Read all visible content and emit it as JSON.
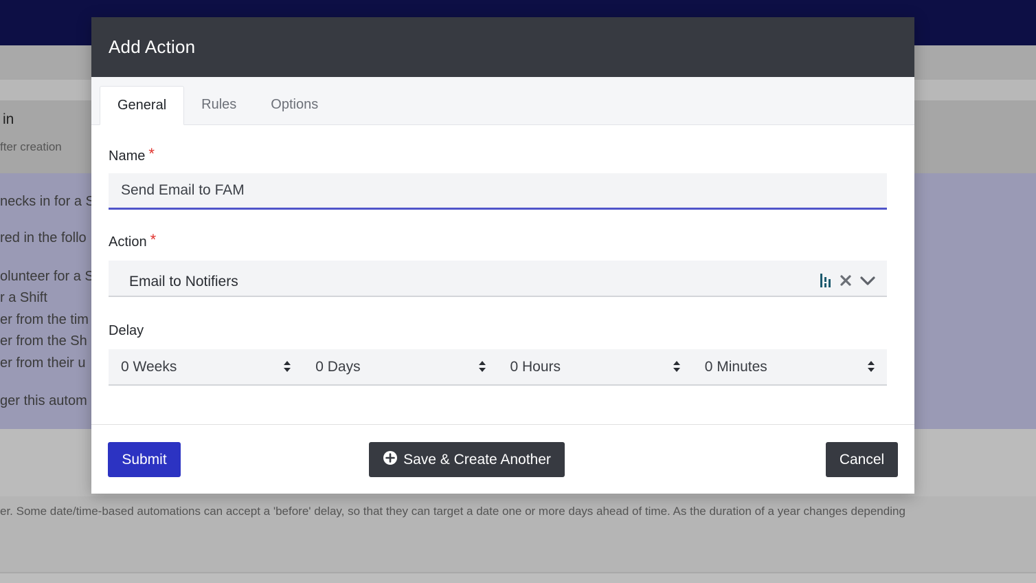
{
  "background": {
    "header_line1": "in",
    "header_line2": "fter creation",
    "rows": [
      "necks in for a S",
      "red in the follo",
      "olunteer for a S",
      "r a Shift",
      "er from the tim",
      "er from the Sh",
      "er from their u",
      "ger this autom"
    ],
    "footer_text": "er. Some date/time-based automations can accept a 'before' delay, so that they can target a date one or more days ahead of time. As the duration of a year changes depending"
  },
  "modal": {
    "title": "Add Action",
    "tabs": [
      {
        "label": "General"
      },
      {
        "label": "Rules"
      },
      {
        "label": "Options"
      }
    ],
    "name_label": "Name",
    "required_mark": "*",
    "name_value": "Send Email to FAM",
    "action_label": "Action",
    "action_value": "Email to Notifiers",
    "delay_label": "Delay",
    "delay": {
      "weeks": "0 Weeks",
      "days": "0 Days",
      "hours": "0 Hours",
      "minutes": "0 Minutes"
    },
    "buttons": {
      "submit": "Submit",
      "save_another": "Save & Create Another",
      "cancel": "Cancel"
    }
  },
  "icons": {
    "action_icon": "bars-icon",
    "clear": "close-icon",
    "dropdown": "chevron-down-icon",
    "plus": "plus-circle-icon",
    "spinner": "sort-updown-icon"
  },
  "colors": {
    "topbar": "#0d0f45",
    "modal_header": "#373a41",
    "primary": "#2c33c2",
    "required": "#e0322d",
    "input_focus": "#4f54c9",
    "icon_teal": "#1d5a6e"
  }
}
